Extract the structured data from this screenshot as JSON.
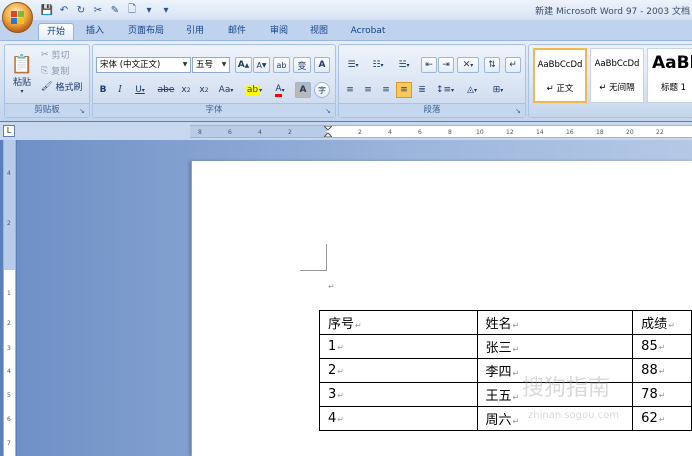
{
  "window": {
    "title": "新建 Microsoft Word 97 - 2003 文档"
  },
  "tabs": [
    "开始",
    "插入",
    "页面布局",
    "引用",
    "邮件",
    "审阅",
    "视图",
    "Acrobat"
  ],
  "clipboard": {
    "paste": "粘贴",
    "cut": "剪切",
    "copy": "复制",
    "format_painter": "格式刷",
    "label": "剪贴板"
  },
  "font": {
    "font_name": "宋体 (中文正文)",
    "font_size": "五号",
    "label": "字体",
    "grow": "A",
    "shrink": "A",
    "clear": "ab",
    "phonetic": "变",
    "border": "A",
    "bold": "B",
    "italic": "I",
    "underline": "U",
    "strike": "abe",
    "subscript": "x",
    "superscript": "x",
    "change_case": "Aa",
    "highlight": "ab",
    "font_color": "A",
    "shading": "A",
    "enclose": "字"
  },
  "paragraph": {
    "label": "段落"
  },
  "styles": {
    "items": [
      {
        "sample": "AaBbCcDd",
        "name": "正文"
      },
      {
        "sample": "AaBbCcDd",
        "name": "无间隔"
      },
      {
        "sample": "AaBb",
        "name": "标题 1"
      }
    ]
  },
  "ruler": {
    "corner": "L",
    "h_ticks": [
      "8",
      "6",
      "4",
      "2",
      "2",
      "4",
      "6",
      "8",
      "10",
      "12",
      "14",
      "16",
      "18",
      "20",
      "22"
    ],
    "v_ticks": [
      "4",
      "2",
      "1",
      "2",
      "3",
      "4",
      "5",
      "6",
      "7"
    ]
  },
  "document": {
    "table": {
      "headers": [
        "序号",
        "姓名",
        "成绩"
      ],
      "rows": [
        [
          "1",
          "张三",
          "85"
        ],
        [
          "2",
          "李四",
          "88"
        ],
        [
          "3",
          "王五",
          "78"
        ],
        [
          "4",
          "周六",
          "62"
        ]
      ]
    },
    "para_mark": "↵"
  },
  "watermark": {
    "text": "搜狗指南",
    "url": "zhinan.sogou.com"
  },
  "colors": {
    "highlight": "#ffff00",
    "font_color": "#ff0000",
    "accent": "#15428b"
  }
}
